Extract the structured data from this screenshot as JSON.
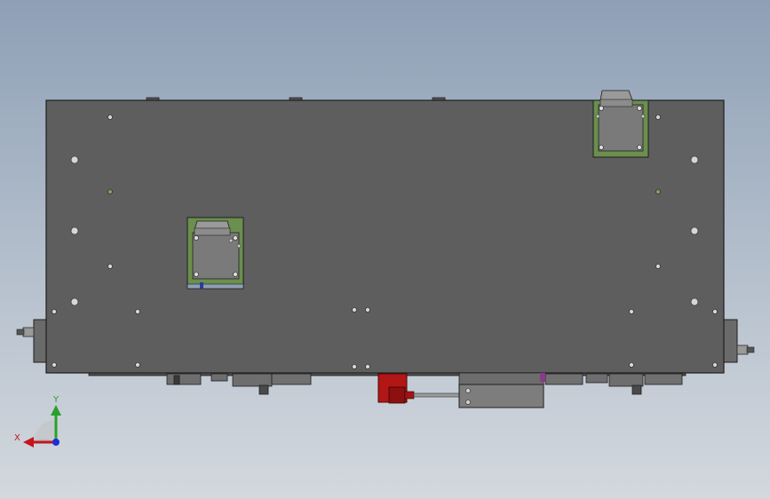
{
  "app": {
    "view": "cad-graphics-viewport"
  },
  "triad": {
    "x_label": "X",
    "y_label": "Y",
    "x_color": "#c4161c",
    "y_color": "#2aa02a",
    "z_color": "#1b2fd6"
  },
  "colors": {
    "background_top": "#8ea0b6",
    "background_bottom": "#d3d8de",
    "plate": "#5e5e5e",
    "plate_edge": "#1e1e1e",
    "motor_mount": "#6b8f4e",
    "motor_body": "#7a7a7a",
    "red_fitting": "#b31616",
    "gray_block": "#7d7d7d"
  },
  "icons": [
    "cad-part-plate",
    "stepper-motor",
    "axis-triad"
  ]
}
